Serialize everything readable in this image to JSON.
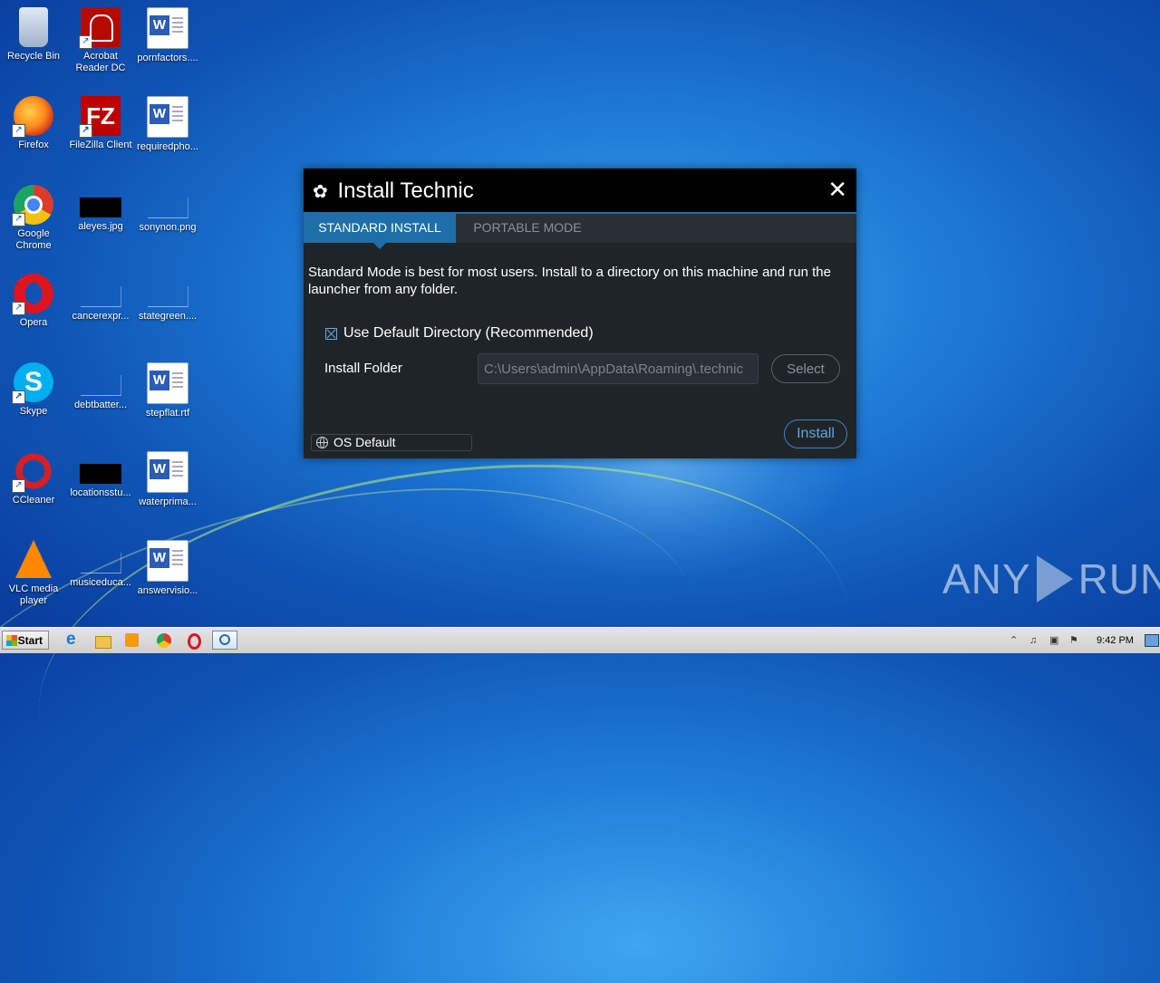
{
  "desktop": {
    "icons": [
      {
        "label": "Recycle Bin"
      },
      {
        "label": "Acrobat Reader DC"
      },
      {
        "label": "pornfactors...."
      },
      {
        "label": "Firefox"
      },
      {
        "label": "FileZilla Client"
      },
      {
        "label": "requiredpho..."
      },
      {
        "label": "Google Chrome"
      },
      {
        "label": "aleyes.jpg"
      },
      {
        "label": "sonynon.png"
      },
      {
        "label": "Opera"
      },
      {
        "label": "cancerexpr..."
      },
      {
        "label": "stategreen...."
      },
      {
        "label": "Skype"
      },
      {
        "label": "debtbatter..."
      },
      {
        "label": "stepflat.rtf"
      },
      {
        "label": "CCleaner"
      },
      {
        "label": "locationsstu..."
      },
      {
        "label": "waterprima..."
      },
      {
        "label": "VLC media player"
      },
      {
        "label": "musiceduca..."
      },
      {
        "label": "answervisio..."
      }
    ],
    "filezilla_glyph": "FZ",
    "skype_glyph": "S",
    "shortcut_glyph": "↗"
  },
  "dialog": {
    "title": "Install Technic",
    "gear_glyph": "✿",
    "close_glyph": "✕",
    "tabs": [
      {
        "label": "STANDARD INSTALL",
        "active": true
      },
      {
        "label": "PORTABLE MODE",
        "active": false
      }
    ],
    "description": "Standard Mode is best for most users. Install to a directory on this machine and run the launcher from any folder.",
    "use_default_label": "Use Default Directory (Recommended)",
    "use_default_checked": true,
    "install_folder_label": "Install Folder",
    "install_folder_value": "C:\\Users\\admin\\AppData\\Roaming\\.technic",
    "select_label": "Select",
    "language_label": "OS Default",
    "install_label": "Install",
    "accent_color": "#1e6fa8"
  },
  "watermark": {
    "left": "ANY",
    "right": "RUN"
  },
  "taskbar": {
    "start_label": "Start",
    "clock": "9:42 PM",
    "tray_glyphs": [
      "⌃",
      "♫",
      "▣",
      "⚑"
    ]
  }
}
